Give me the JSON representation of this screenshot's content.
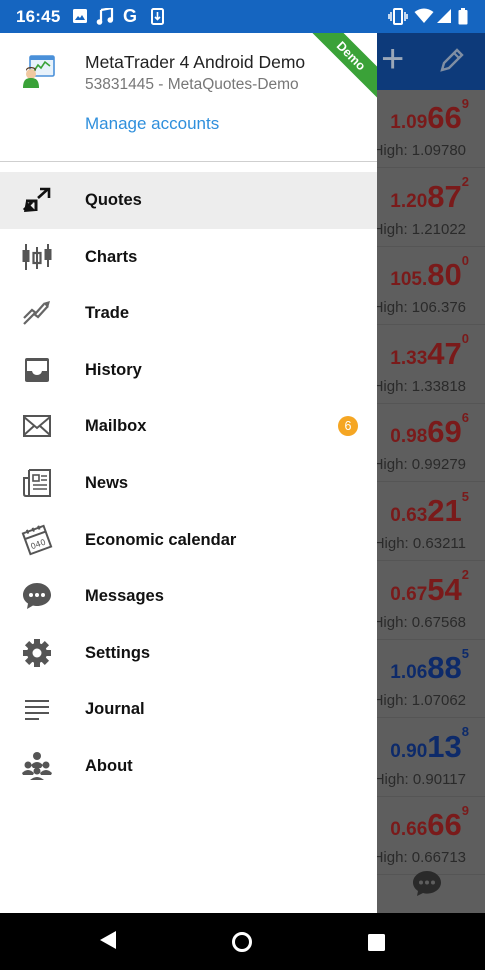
{
  "status_bar": {
    "time": "16:45",
    "left_icons": [
      "image-icon",
      "music-icon",
      "google-icon",
      "download-icon"
    ],
    "right_icons": [
      "vibrate-icon",
      "wifi-icon",
      "signal-icon",
      "battery-icon"
    ]
  },
  "drawer": {
    "account": {
      "name": "MetaTrader 4 Android Demo",
      "subtitle": "53831445 - MetaQuotes-Demo",
      "manage_label": "Manage accounts",
      "ribbon": "Demo"
    },
    "menu": [
      {
        "label": "Quotes",
        "icon": "quotes-icon",
        "active": true
      },
      {
        "label": "Charts",
        "icon": "candlestick-chart-icon"
      },
      {
        "label": "Trade",
        "icon": "trade-icon"
      },
      {
        "label": "History",
        "icon": "history-inbox-icon"
      },
      {
        "label": "Mailbox",
        "icon": "mail-envelope-icon",
        "badge": "6"
      },
      {
        "label": "News",
        "icon": "newspaper-icon"
      },
      {
        "label": "Economic calendar",
        "icon": "calendar-icon"
      },
      {
        "label": "Messages",
        "icon": "chat-bubble-icon"
      },
      {
        "label": "Settings",
        "icon": "gear-icon"
      },
      {
        "label": "Journal",
        "icon": "journal-lines-icon"
      },
      {
        "label": "About",
        "icon": "about-icon"
      }
    ]
  },
  "quotes": [
    {
      "prefix": "1.09",
      "big": "66",
      "sup": "9",
      "high": "High: 1.09780",
      "color": "red"
    },
    {
      "prefix": "1.20",
      "big": "87",
      "sup": "2",
      "high": "High: 1.21022",
      "color": "red"
    },
    {
      "prefix": "105.",
      "big": "80",
      "sup": "0",
      "high": "High: 106.376",
      "color": "red"
    },
    {
      "prefix": "1.33",
      "big": "47",
      "sup": "0",
      "high": "High: 1.33818",
      "color": "red"
    },
    {
      "prefix": "0.98",
      "big": "69",
      "sup": "6",
      "high": "High: 0.99279",
      "color": "red"
    },
    {
      "prefix": "0.63",
      "big": "21",
      "sup": "5",
      "high": "High: 0.63211",
      "color": "red"
    },
    {
      "prefix": "0.67",
      "big": "54",
      "sup": "2",
      "high": "High: 0.67568",
      "color": "red"
    },
    {
      "prefix": "1.06",
      "big": "88",
      "sup": "5",
      "high": "High: 1.07062",
      "color": "blue"
    },
    {
      "prefix": "0.90",
      "big": "13",
      "sup": "8",
      "high": "High: 0.90117",
      "color": "blue"
    },
    {
      "prefix": "0.66",
      "big": "66",
      "sup": "9",
      "high": "High: 0.66713",
      "color": "red"
    }
  ],
  "colors": {
    "status_bar": "#1565c0",
    "accent_link": "#2f8fdc",
    "badge": "#f5a623",
    "ribbon": "#3aa238",
    "price_red": "#7a1a1a",
    "price_blue": "#0d2a6a"
  }
}
